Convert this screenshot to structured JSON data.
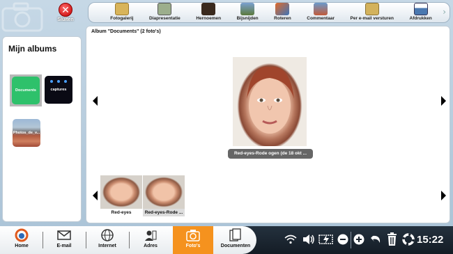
{
  "close": {
    "label": "Sluiten",
    "icon": "close-icon"
  },
  "toolbar": {
    "items": [
      {
        "label": "Fotogalerij",
        "icon": "photo-gallery-icon",
        "color": "#d8b45a"
      },
      {
        "label": "Diapresentatie",
        "icon": "slideshow-icon",
        "color": "#9cae8c"
      },
      {
        "label": "Hernoemen",
        "icon": "rename-icon",
        "color": "#3a2a1e"
      },
      {
        "label": "Bijsnijden",
        "icon": "crop-icon",
        "color": "#5c7a3c"
      },
      {
        "label": "Roteren",
        "icon": "rotate-icon",
        "color": "#3d74b8"
      },
      {
        "label": "Commentaar",
        "icon": "comment-icon",
        "color": "#c25a3a"
      },
      {
        "label": "Per e-mail versturen",
        "icon": "email-send-icon",
        "color": "#d3b25c"
      },
      {
        "label": "Afdrukken",
        "icon": "print-icon",
        "color": "#4a78b0"
      }
    ],
    "more_icon": "chevron-right-icon"
  },
  "sidebar": {
    "title": "Mijn albums",
    "albums": [
      {
        "label": "Documents"
      },
      {
        "label": "captures"
      },
      {
        "label": "Photos_de_v..."
      }
    ]
  },
  "main": {
    "album_title": "Album \"Documents\" (2 foto's)",
    "current_caption": "Red-eyes-Rode ogen (de 18 okt ...",
    "thumbnails": [
      {
        "label": "Red-eyes"
      },
      {
        "label": "Red-eyes-Rode ..."
      }
    ]
  },
  "taskbar": {
    "items": [
      {
        "label": "Home",
        "icon": "home-icon"
      },
      {
        "label": "E-mail",
        "icon": "email-icon"
      },
      {
        "label": "Internet",
        "icon": "globe-icon"
      },
      {
        "label": "Adres",
        "icon": "contacts-icon"
      },
      {
        "label": "Foto's",
        "icon": "camera-icon",
        "active": true
      },
      {
        "label": "Documenten",
        "icon": "documents-icon"
      }
    ],
    "clock": "15:22",
    "accent": "#f5921e"
  }
}
